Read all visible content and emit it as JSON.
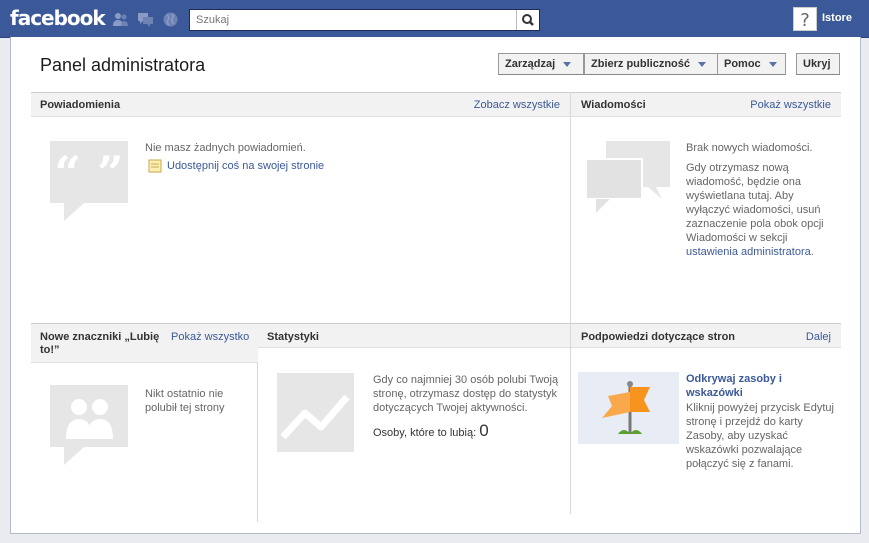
{
  "topbar": {
    "logo": "facebook",
    "search_placeholder": "Szukaj",
    "search_value": "",
    "user_name": "Istore"
  },
  "panel": {
    "title": "Panel administratora",
    "buttons": {
      "manage": "Zarządzaj",
      "audience": "Zbierz publiczność",
      "help": "Pomoc",
      "hide": "Ukryj"
    }
  },
  "notifications": {
    "title": "Powiadomienia",
    "link": "Zobacz wszystkie",
    "empty": "Nie masz żadnych powiadomień.",
    "share_link": "Udostępnij coś na swojej stronie"
  },
  "messages": {
    "title": "Wiadomości",
    "link": "Pokaż wszystkie",
    "empty": "Brak nowych wiadomości.",
    "info": [
      "Gdy otrzymasz nową",
      "wiadomość, będzie ona",
      "wyświetlana tutaj. Aby",
      "wyłączyć wiadomości, usuń",
      "zaznaczenie pola obok opcji",
      "Wiadomości w sekcji"
    ],
    "settings_link": "ustawienia administratora",
    "settings_suffix": "."
  },
  "likes": {
    "title_line1": "Nowe znaczniki „Lubię",
    "title_line2": "to!”",
    "link": "Pokaż wszystko",
    "empty_line1": "Nikt ostatnio nie",
    "empty_line2": "polubił tej strony"
  },
  "stats": {
    "title": "Statystyki",
    "info": [
      "Gdy co najmniej 30 osób polubi Twoją",
      "stronę, otrzymasz dostęp do statystyk",
      "dotyczących Twojej aktywności."
    ],
    "likes_label": "Osoby, które to lubią:",
    "likes_count": "0"
  },
  "tips": {
    "title": "Podpowiedzi dotyczące stron",
    "link": "Dalej",
    "tip_title_line1": "Odkrywaj zasoby i",
    "tip_title_line2": "wskazówki",
    "tip_text": [
      "Kliknij powyżej przycisk Edytuj",
      "stronę i przejdź do karty",
      "Zasoby, aby uzyskać",
      "wskazówki pozwalające",
      "połączyć się z fanami."
    ]
  },
  "colors": {
    "brand": "#3b5998",
    "placeholder_gray": "#e6e6e6",
    "flag_orange": "#f7941d"
  },
  "icons": [
    "friend-requests-icon",
    "messages-icon",
    "notifications-globe-icon",
    "search-icon",
    "help-icon",
    "quote-bubble-icon",
    "page-note-icon",
    "chat-bubbles-icon",
    "people-bubble-icon",
    "chart-placeholder-icon",
    "flag-icon"
  ]
}
